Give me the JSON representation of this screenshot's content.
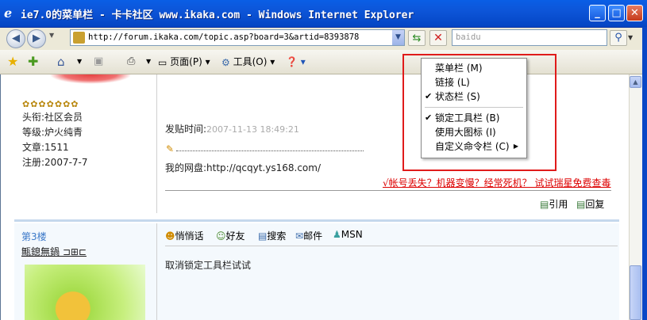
{
  "window": {
    "title": "ie7.0的菜单栏 - 卡卡社区 www.ikaka.com - Windows Internet Explorer",
    "minimize": "_",
    "maximize": "□",
    "close": "✕"
  },
  "address_bar": {
    "url": "http://forum.ikaka.com/topic.asp?board=3&artid=8393878",
    "search_placeholder": "baidu"
  },
  "command_bar": {
    "page": "页面(P)",
    "tools": "工具(O)"
  },
  "post1": {
    "stars": "✿✿✿✿✿✿✿",
    "title_line": "头衔:社区会员",
    "level_line": "等级:炉火纯青",
    "articles_line": "文章:1511",
    "register_line": "注册:2007-7-7",
    "time_label": "发贴时间:",
    "time_value": "2007-11-13 18:49:21",
    "netdisk": "我的网盘:http://qcqyt.ys168.com/",
    "ad": "√帐号丢失？机器变慢？经常死机？ 试试瑞星免费查毒",
    "quote": "引用",
    "reply": "回复"
  },
  "post2": {
    "floor": "第3楼",
    "username": "甒鎴無鍋 ⊐⊞⊏",
    "tools": [
      "悄悄话",
      "好友",
      "搜索",
      "邮件",
      "MSN"
    ],
    "text": "取消锁定工具栏试试"
  },
  "context_menu": {
    "items": [
      {
        "label": "菜单栏 (M)",
        "checked": ""
      },
      {
        "label": "链接 (L)",
        "checked": ""
      },
      {
        "label": "状态栏 (S)",
        "checked": "✔"
      },
      {
        "label": "锁定工具栏 (B)",
        "checked": "✔"
      },
      {
        "label": "使用大图标 (I)",
        "checked": ""
      },
      {
        "label": "自定义命令栏 (C)",
        "checked": ""
      }
    ]
  }
}
